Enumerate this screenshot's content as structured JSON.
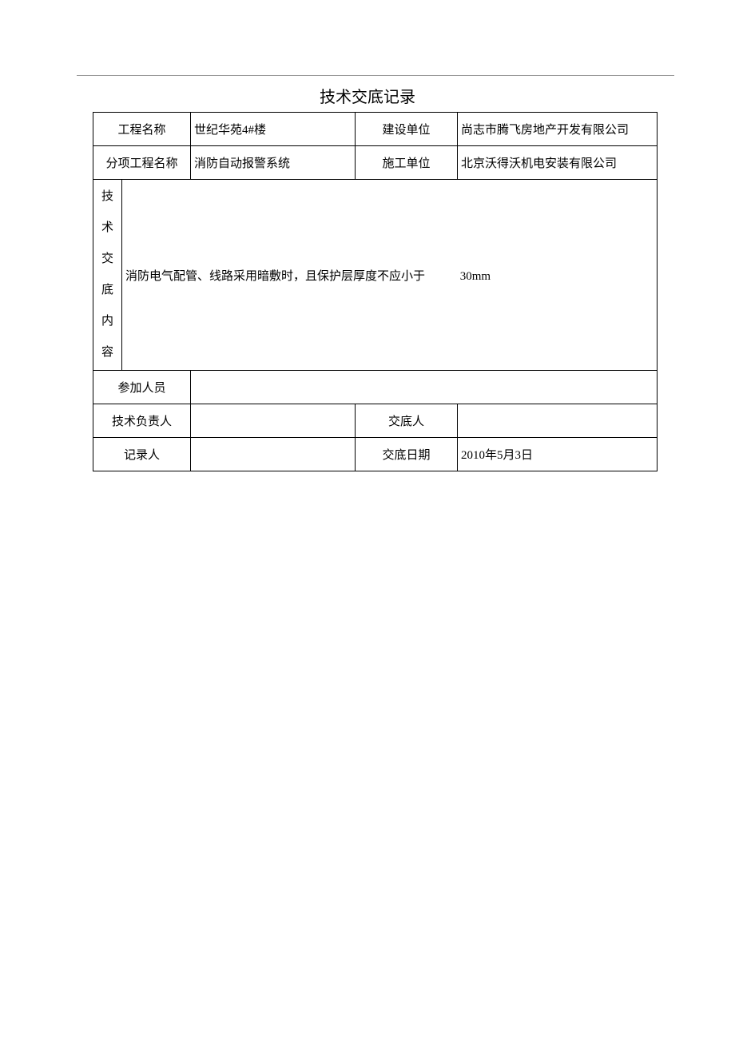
{
  "title": "技术交底记录",
  "row1": {
    "label": "工程名称",
    "value": "世纪华苑4#楼",
    "label2": "建设单位",
    "value2": "尚志市腾飞房地产开发有限公司"
  },
  "row2": {
    "label": "分项工程名称",
    "value": "消防自动报警系统",
    "label2": "施工单位",
    "value2": "北京沃得沃机电安装有限公司"
  },
  "content": {
    "sideLabel": "技\n术\n交\n底\n内\n容",
    "text1": "消防电气配管、线路采用暗敷时，且保护层厚度不应小于",
    "text2": "30mm"
  },
  "participants": {
    "label": "参加人员",
    "value": ""
  },
  "techLead": {
    "label": "技术负责人",
    "value": "",
    "label2": "交底人",
    "value2": ""
  },
  "recorder": {
    "label": "记录人",
    "value": "",
    "label2": "交底日期",
    "value2": "2010年5月3日"
  }
}
